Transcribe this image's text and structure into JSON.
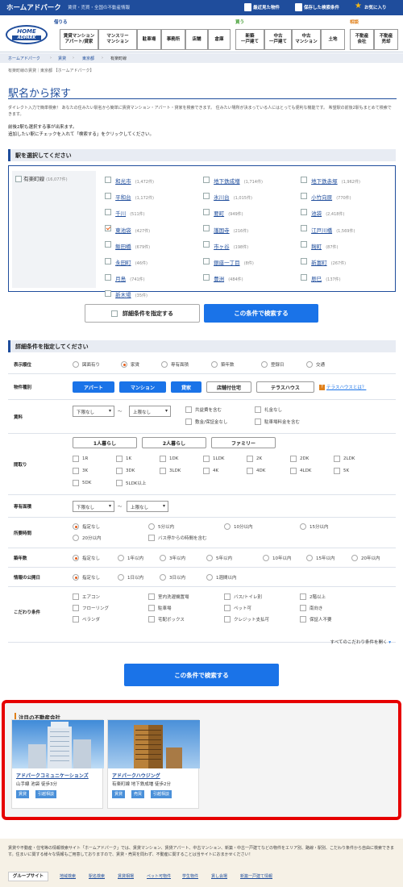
{
  "header": {
    "site_name": "ホームアドパーク",
    "tagline": "賃貸・売買・全国の不動産情報",
    "links": [
      "最近見た物件",
      "保存した検索条件",
      "お気に入り"
    ]
  },
  "nav": {
    "logo_line1": "HOME",
    "logo_line2": "ADPARK",
    "rent_label": "借りる",
    "buy_label": "買う",
    "consult_label": "相談",
    "rent_items": [
      "賃貸マンション\nアパート/貸家",
      "マンスリー\nマンション",
      "駐車場",
      "事務所",
      "店舗",
      "倉庫"
    ],
    "buy_items": [
      "新築\n一戸建て",
      "中古\n一戸建て",
      "中古\nマンション",
      "土地"
    ],
    "consult_items": [
      "不動産\n会社",
      "不動産\n売却"
    ]
  },
  "breadcrumb": [
    "ホームアドパーク",
    "賃貸",
    "東京都",
    "有楽町線"
  ],
  "page_sub": "有楽町線の賃貸｜東京都 【ホームアドパーク】",
  "title": "駅名から探す",
  "desc": "ダイレクト入力で簡単検索！ あなたの住みたい駅名から簡単に賃貸マンション・アパート・貸家を検索できます。 住みたい場所が決まっている人にはとっても便利な機能です。 希望駅の前後2駅もまとめて検索できます。",
  "instructions": [
    "前後2駅も選択する事が出来ます。",
    "追加したい駅にチェックを入れて「検索する」をクリックしてください。"
  ],
  "station_section": {
    "heading": "駅を選択してください",
    "line_name": "有楽町線",
    "line_count": "(16,077件)",
    "stations": [
      {
        "name": "和光市",
        "count": "(1,472件)",
        "checked": false
      },
      {
        "name": "地下鉄成増",
        "count": "(1,714件)",
        "checked": false
      },
      {
        "name": "地下鉄赤塚",
        "count": "(1,962件)",
        "checked": false
      },
      {
        "name": "平和台",
        "count": "(1,172件)",
        "checked": false
      },
      {
        "name": "氷川台",
        "count": "(1,015件)",
        "checked": false
      },
      {
        "name": "小竹向原",
        "count": "(770件)",
        "checked": false
      },
      {
        "name": "千川",
        "count": "(511件)",
        "checked": false
      },
      {
        "name": "要町",
        "count": "(949件)",
        "checked": false
      },
      {
        "name": "池袋",
        "count": "(2,418件)",
        "checked": false
      },
      {
        "name": "東池袋",
        "count": "(427件)",
        "checked": true
      },
      {
        "name": "護国寺",
        "count": "(216件)",
        "checked": false
      },
      {
        "name": "江戸川橋",
        "count": "(1,569件)",
        "checked": false
      },
      {
        "name": "飯田橋",
        "count": "(679件)",
        "checked": false
      },
      {
        "name": "市ヶ谷",
        "count": "(198件)",
        "checked": false
      },
      {
        "name": "麹町",
        "count": "(87件)",
        "checked": false
      },
      {
        "name": "永田町",
        "count": "(46件)",
        "checked": false
      },
      {
        "name": "銀座一丁目",
        "count": "(8件)",
        "checked": false
      },
      {
        "name": "新富町",
        "count": "(267件)",
        "checked": false
      },
      {
        "name": "月島",
        "count": "(741件)",
        "checked": false
      },
      {
        "name": "豊洲",
        "count": "(484件)",
        "checked": false
      },
      {
        "name": "辰巳",
        "count": "(137件)",
        "checked": false
      },
      {
        "name": "新木場",
        "count": "(35件)",
        "checked": false
      }
    ]
  },
  "buttons": {
    "detail": "詳細条件を指定する",
    "search": "この条件で検索する",
    "search2": "この条件で検索する"
  },
  "detail_section": {
    "heading": "詳細条件を指定してください",
    "sort": {
      "label": "表示順位",
      "options": [
        "図面有り",
        "家賃",
        "専有面積",
        "築年数",
        "登録日",
        "交通"
      ],
      "selected": 1
    },
    "type": {
      "label": "物件種別",
      "options": [
        "アパート",
        "マンション",
        "貸家",
        "店舗付住宅",
        "テラスハウス"
      ],
      "selected": [
        0,
        1,
        2
      ],
      "help": "テラスハウスとは？"
    },
    "rent": {
      "label": "賃料",
      "min": "下限なし",
      "max": "上限なし",
      "tilde": "〜",
      "checks": [
        "共益費を含む",
        "礼金なし",
        "敷金/保証金なし",
        "駐車場料金を含む"
      ]
    },
    "layout": {
      "label": "間取り",
      "presets": [
        "1人暮らし",
        "2人暮らし",
        "ファミリー"
      ],
      "options": [
        "1R",
        "1K",
        "1DK",
        "1LDK",
        "2K",
        "2DK",
        "2LDK",
        "3K",
        "3DK",
        "3LDK",
        "4K",
        "4DK",
        "4LDK",
        "5K",
        "5DK",
        "5LDK以上"
      ]
    },
    "area": {
      "label": "専有面積",
      "min": "下限なし",
      "max": "上限なし",
      "tilde": "〜"
    },
    "time": {
      "label": "所要時間",
      "options": [
        "指定なし",
        "5分以内",
        "10分以内",
        "15分以内",
        "20分以内"
      ],
      "bus": "バス停からの時間を含む"
    },
    "age": {
      "label": "築年数",
      "options": [
        "指定なし",
        "1年以内",
        "3年以内",
        "5年以内",
        "10年以内",
        "15年以内",
        "20年以内"
      ]
    },
    "published": {
      "label": "情報の公開日",
      "options": [
        "指定なし",
        "1日以内",
        "3日以内",
        "1週間以内"
      ]
    },
    "features": {
      "label": "こだわり条件",
      "options": [
        "エアコン",
        "室内洗濯機置場",
        "バス/トイレ別",
        "2階以上",
        "フローリング",
        "駐車場",
        "ペット可",
        "南向き",
        "ベランダ",
        "宅配ボックス",
        "クレジット支払可",
        "保証人不要"
      ],
      "more": "すべてのこだわり条件を開く"
    }
  },
  "featured": {
    "heading": "注目の不動産会社",
    "companies": [
      {
        "name": "アドパークコミュニケーションズ",
        "desc": "山手線 池袋 徒歩3分",
        "tags": [
          "賃貸",
          "引越相談"
        ]
      },
      {
        "name": "アドパークハウジング",
        "desc": "有楽町線 地下鉄成増 徒歩2分",
        "tags": [
          "賃貸",
          "売買",
          "引越相談"
        ]
      }
    ]
  },
  "footer": {
    "text": "賃貸や不動産・住宅等の情報検索サイト「ホームアドパーク」では、賃貸マンション、賃貸アパート、中古マンション、新築・中古一戸建てなどの物件をエリア別、路線・駅別、こだわり条件から自由に検索できます。住まいに関する様々な情報もご用意しておりますので、賃貸・売買を問わず、不動産に関することは当サイトにおまかせください！",
    "group_label": "グループサイト",
    "links": [
      "地域検索",
      "駅名検索",
      "賃貸相場",
      "ペット可物件",
      "学生物件",
      "賃し会場",
      "新築一戸建て情報"
    ]
  },
  "colors": {
    "brand": "#1f4d9c",
    "primary_button": "#1a73e8",
    "highlight_border": "#e60000",
    "checked_accent": "#e65c18"
  }
}
